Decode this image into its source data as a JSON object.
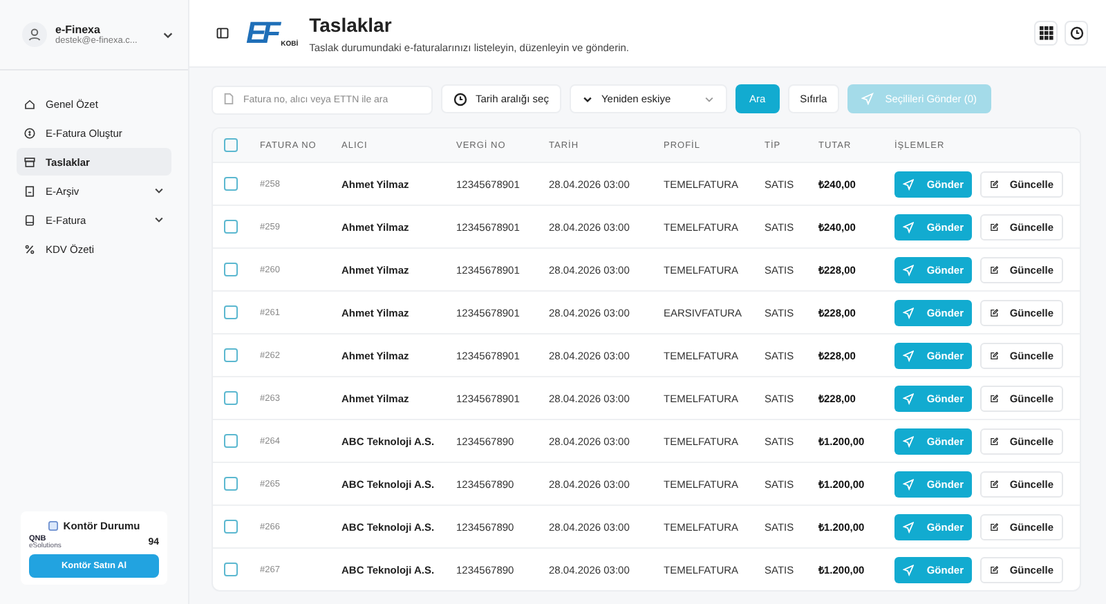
{
  "account": {
    "name": "e-Finexa",
    "email": "destek@e-finexa.c..."
  },
  "sidebar": {
    "items": [
      {
        "label": "Genel Özet",
        "selected": false,
        "expandable": false
      },
      {
        "label": "E-Fatura Oluştur",
        "selected": false,
        "expandable": false
      },
      {
        "label": "Taslaklar",
        "selected": true,
        "expandable": false
      },
      {
        "label": "E-Arşiv",
        "selected": false,
        "expandable": true
      },
      {
        "label": "E-Fatura",
        "selected": false,
        "expandable": true
      },
      {
        "label": "KDV Özeti",
        "selected": false,
        "expandable": false
      }
    ]
  },
  "credit": {
    "title": "Kontör Durumu",
    "provider": "QNB",
    "provider_sub": "eSolutions",
    "count": "94",
    "button": "Kontör Satın Al"
  },
  "logo": {
    "mark": "EF",
    "sub": "KOBİ"
  },
  "header": {
    "title": "Taslaklar",
    "subtitle": "Taslak durumundaki e-faturalarınızı listeleyin, düzenleyin ve gönderin."
  },
  "toolbar": {
    "search_placeholder": "Fatura no, alıcı veya ETTN ile ara",
    "date_button": "Tarih aralığı seç",
    "sort": "Yeniden eskiye",
    "search_button": "Ara",
    "reset_button": "Sıfırla",
    "send_selected": {
      "label": "Seçilileri Gönder (0)",
      "disabled": true
    }
  },
  "table": {
    "columns": [
      "FATURA NO",
      "ALICI",
      "VERGİ NO",
      "TARİH",
      "PROFİL",
      "TİP",
      "TUTAR",
      "İŞLEMLER"
    ],
    "select_all": false,
    "rows": [
      {
        "no": "#258",
        "alici": "Ahmet Yilmaz",
        "vergi": "12345678901",
        "tarih": "28.04.2026 03:00",
        "profil": "TEMELFATURA",
        "tip": "SATIS",
        "tutar": "₺240,00",
        "checked": false,
        "send": "Gönder",
        "edit": "Güncelle"
      },
      {
        "no": "#259",
        "alici": "Ahmet Yilmaz",
        "vergi": "12345678901",
        "tarih": "28.04.2026 03:00",
        "profil": "TEMELFATURA",
        "tip": "SATIS",
        "tutar": "₺240,00",
        "checked": false,
        "send": "Gönder",
        "edit": "Güncelle"
      },
      {
        "no": "#260",
        "alici": "Ahmet Yilmaz",
        "vergi": "12345678901",
        "tarih": "28.04.2026 03:00",
        "profil": "TEMELFATURA",
        "tip": "SATIS",
        "tutar": "₺228,00",
        "checked": false,
        "send": "Gönder",
        "edit": "Güncelle"
      },
      {
        "no": "#261",
        "alici": "Ahmet Yilmaz",
        "vergi": "12345678901",
        "tarih": "28.04.2026 03:00",
        "profil": "EARSIVFATURA",
        "tip": "SATIS",
        "tutar": "₺228,00",
        "checked": false,
        "send": "Gönder",
        "edit": "Güncelle"
      },
      {
        "no": "#262",
        "alici": "Ahmet Yilmaz",
        "vergi": "12345678901",
        "tarih": "28.04.2026 03:00",
        "profil": "TEMELFATURA",
        "tip": "SATIS",
        "tutar": "₺228,00",
        "checked": false,
        "send": "Gönder",
        "edit": "Güncelle"
      },
      {
        "no": "#263",
        "alici": "Ahmet Yilmaz",
        "vergi": "12345678901",
        "tarih": "28.04.2026 03:00",
        "profil": "TEMELFATURA",
        "tip": "SATIS",
        "tutar": "₺228,00",
        "checked": false,
        "send": "Gönder",
        "edit": "Güncelle"
      },
      {
        "no": "#264",
        "alici": "ABC Teknoloji A.S.",
        "vergi": "1234567890",
        "tarih": "28.04.2026 03:00",
        "profil": "TEMELFATURA",
        "tip": "SATIS",
        "tutar": "₺1.200,00",
        "checked": false,
        "send": "Gönder",
        "edit": "Güncelle"
      },
      {
        "no": "#265",
        "alici": "ABC Teknoloji A.S.",
        "vergi": "1234567890",
        "tarih": "28.04.2026 03:00",
        "profil": "TEMELFATURA",
        "tip": "SATIS",
        "tutar": "₺1.200,00",
        "checked": false,
        "send": "Gönder",
        "edit": "Güncelle"
      },
      {
        "no": "#266",
        "alici": "ABC Teknoloji A.S.",
        "vergi": "1234567890",
        "tarih": "28.04.2026 03:00",
        "profil": "TEMELFATURA",
        "tip": "SATIS",
        "tutar": "₺1.200,00",
        "checked": false,
        "send": "Gönder",
        "edit": "Güncelle"
      },
      {
        "no": "#267",
        "alici": "ABC Teknoloji A.S.",
        "vergi": "1234567890",
        "tarih": "28.04.2026 03:00",
        "profil": "TEMELFATURA",
        "tip": "SATIS",
        "tutar": "₺1.200,00",
        "checked": false,
        "send": "Gönder",
        "edit": "Güncelle"
      }
    ]
  }
}
